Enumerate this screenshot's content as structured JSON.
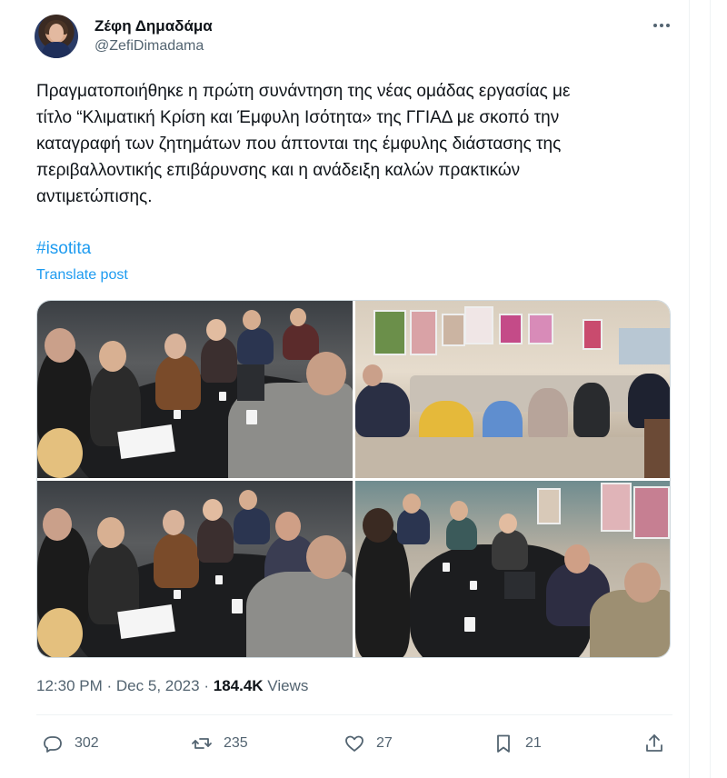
{
  "author": {
    "name": "Ζέφη Δημαδάμα",
    "handle": "@ZefiDimadama"
  },
  "post": {
    "text": "Πραγματοποιήθηκε η πρώτη συνάντηση της νέας ομάδας εργασίας με\nτίτλο “Κλιματική Κρίση και Έμφυλη Ισότητα» της ΓΓΙΑΔ με σκοπό την\nκαταγραφή των ζητημάτων που άπτονται της έμφυλης διάστασης της\nπεριβαλλοντικής επιβάρυνσης και η ανάδειξη  καλών πρακτικών\nαντιμετώπισης.",
    "hashtag": "#isotita",
    "translate_label": "Translate post"
  },
  "meta": {
    "time": "12:30 PM",
    "separator": "·",
    "date": "Dec 5, 2023",
    "views_count": "184.4K",
    "views_label": "Views"
  },
  "actions": {
    "replies": "302",
    "reposts": "235",
    "likes": "27",
    "bookmarks": "21"
  },
  "icons": {
    "more": "more-horizontal-icon",
    "reply": "reply-icon",
    "repost": "repost-icon",
    "like": "heart-icon",
    "bookmark": "bookmark-icon",
    "share": "share-icon"
  },
  "colors": {
    "accent": "#1d9bf0",
    "secondary_text": "#536471",
    "primary_text": "#0f1419"
  }
}
